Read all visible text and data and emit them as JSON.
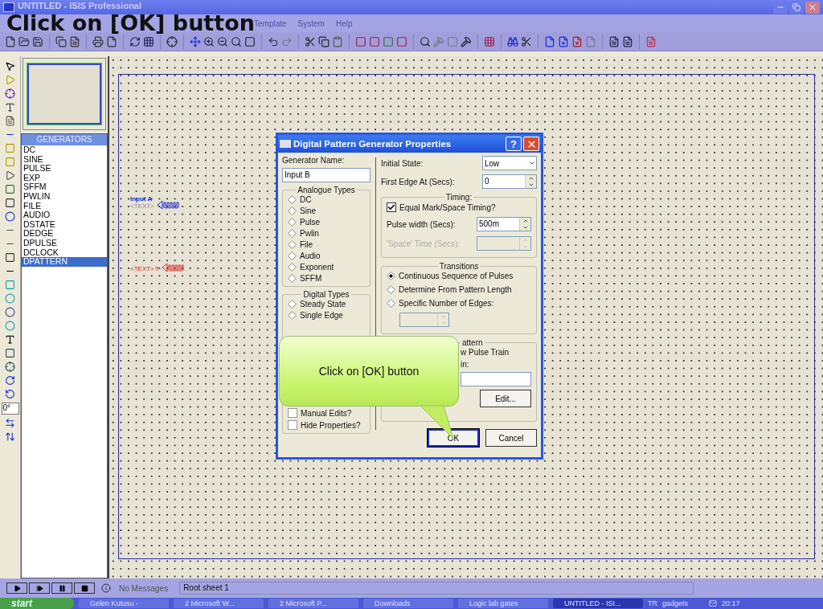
{
  "window": {
    "title": "UNTITLED - ISIS Professional"
  },
  "caption": "Click on [OK] button",
  "menu": [
    "Template",
    "System",
    "Help"
  ],
  "picker": {
    "title": "GENERATORS",
    "items": [
      {
        "label": "DC",
        "selected": false
      },
      {
        "label": "SINE",
        "selected": false
      },
      {
        "label": "PULSE",
        "selected": false
      },
      {
        "label": "EXP",
        "selected": false
      },
      {
        "label": "SFFM",
        "selected": false
      },
      {
        "label": "PWLIN",
        "selected": false
      },
      {
        "label": "FILE",
        "selected": false
      },
      {
        "label": "AUDIO",
        "selected": false
      },
      {
        "label": "DSTATE",
        "selected": false
      },
      {
        "label": "DEDGE",
        "selected": false
      },
      {
        "label": "DPULSE",
        "selected": false
      },
      {
        "label": "DCLOCK",
        "selected": false
      },
      {
        "label": "DPATTERN",
        "selected": true
      }
    ]
  },
  "rotation": "0°",
  "canvas": {
    "generators": [
      {
        "kind": "placed",
        "name": "Input A",
        "text": "<TEXT>"
      },
      {
        "kind": "ghost",
        "name": "?",
        "text": "<TEXT>"
      }
    ]
  },
  "dialog": {
    "title": "Digital Pattern Generator Properties",
    "help": "?",
    "name_label": "Generator Name:",
    "name_value": "Input B",
    "analogue": {
      "title": "Analogue Types",
      "options": [
        {
          "label": "DC",
          "selected": false
        },
        {
          "label": "Sine",
          "selected": false
        },
        {
          "label": "Pulse",
          "selected": false
        },
        {
          "label": "Pwlin",
          "selected": false
        },
        {
          "label": "File",
          "selected": false
        },
        {
          "label": "Audio",
          "selected": false
        },
        {
          "label": "Exponent",
          "selected": false
        },
        {
          "label": "SFFM",
          "selected": false
        }
      ]
    },
    "digital": {
      "title": "Digital Types",
      "options": [
        {
          "label": "Steady State",
          "selected": false
        },
        {
          "label": "Single Edge",
          "selected": false
        }
      ]
    },
    "checkboxes": [
      {
        "label": "Manual Edits?",
        "checked": false
      },
      {
        "label": "Hide Properties?",
        "checked": false
      }
    ],
    "initial_state": {
      "label": "Initial State:",
      "value": "Low"
    },
    "first_edge": {
      "label": "First Edge At (Secs):",
      "value": "0"
    },
    "timing": {
      "title": "Timing:",
      "equal": {
        "label": "Equal Mark/Space Timing?",
        "checked": true
      },
      "pulse_width": {
        "label": "Pulse width (Secs):",
        "value": "500m",
        "disabled": false
      },
      "space_time": {
        "label": "'Space' Time (Secs):",
        "disabled": true
      }
    },
    "transitions": {
      "title": "Transitions",
      "options": [
        {
          "label": "Continuous Sequence of Pulses",
          "selected": true
        },
        {
          "label": "Determine From Pattern Length",
          "selected": false
        },
        {
          "label": "Specific Number of Edges:",
          "selected": false
        }
      ],
      "edges_disabled": true
    },
    "pattern": {
      "title": "attern",
      "lines": [
        "w Pulse Train",
        "in:"
      ],
      "edit": "Edit..."
    },
    "buttons": [
      {
        "label": "OK",
        "default": true
      },
      {
        "label": "Cancel",
        "default": false
      }
    ]
  },
  "callout": "Click on [OK] button",
  "status": {
    "messages": "No Messages",
    "sheet": "Root sheet 1"
  },
  "taskbar": {
    "start": "start",
    "tasks": [
      {
        "label": "Gelen Kutusu -",
        "selected": false
      },
      {
        "label": "2 Microsoft W...",
        "selected": false
      },
      {
        "label": "2 Microsoft P...",
        "selected": false
      },
      {
        "label": "Downloads",
        "selected": false
      },
      {
        "label": "Logic lab gates",
        "selected": false
      },
      {
        "label": "UNTITLED - ISI...",
        "selected": true
      }
    ],
    "language": "TR",
    "gadgets": "gadgets",
    "clock": "20:17"
  }
}
